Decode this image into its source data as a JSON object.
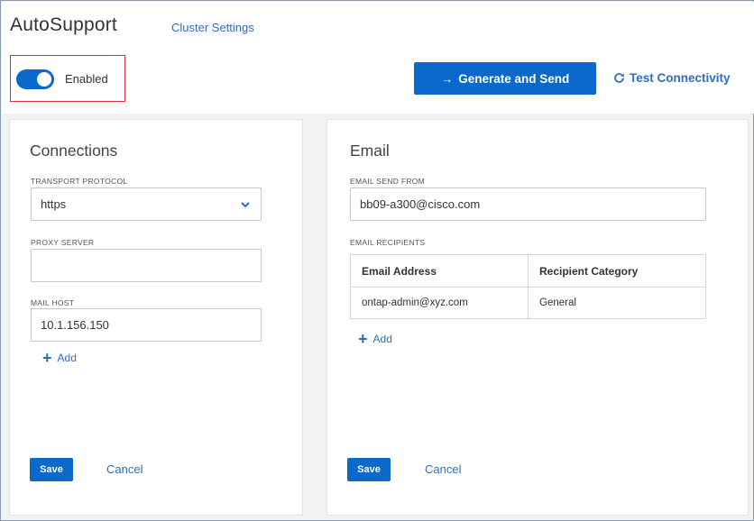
{
  "header": {
    "title": "AutoSupport",
    "cluster_settings_link": "Cluster Settings",
    "toggle_label": "Enabled",
    "toggle_on": true,
    "generate_button": "Generate and Send",
    "test_connectivity": "Test Connectivity"
  },
  "connections": {
    "title": "Connections",
    "transport_protocol_label": "TRANSPORT PROTOCOL",
    "transport_protocol_value": "https",
    "proxy_server_label": "PROXY SERVER",
    "proxy_server_value": "",
    "mail_host_label": "MAIL HOST",
    "mail_host_value": "10.1.156.150",
    "add_label": "Add",
    "save_label": "Save",
    "cancel_label": "Cancel"
  },
  "email": {
    "title": "Email",
    "send_from_label": "EMAIL SEND FROM",
    "send_from_value": "bb09-a300@cisco.com",
    "recipients_label": "EMAIL RECIPIENTS",
    "table": {
      "columns": [
        "Email Address",
        "Recipient Category"
      ],
      "rows": [
        [
          "ontap-admin@xyz.com",
          "General"
        ]
      ]
    },
    "add_label": "Add",
    "save_label": "Save",
    "cancel_label": "Cancel"
  },
  "colors": {
    "accent": "#0a6acb",
    "link": "#2f6ec1",
    "highlight_border": "#d9303a"
  }
}
